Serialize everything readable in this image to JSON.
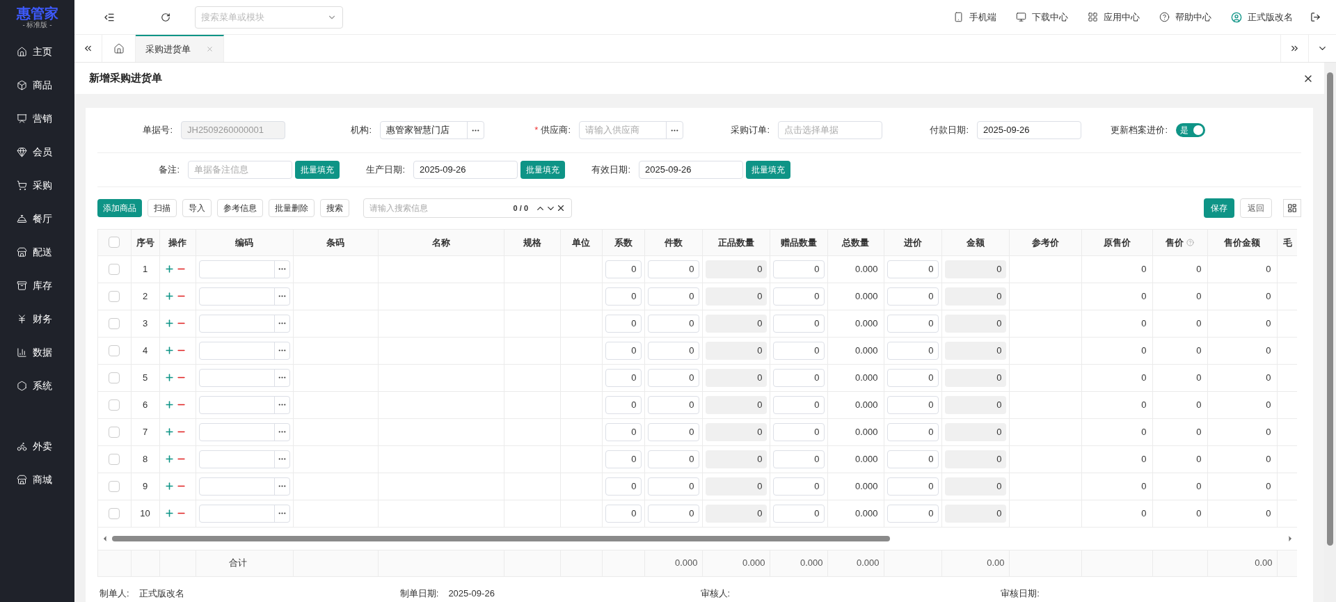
{
  "logo": {
    "name": "惠管家",
    "edition": "- 标准版 -"
  },
  "sidebar": {
    "items": [
      {
        "label": "主页"
      },
      {
        "label": "商品"
      },
      {
        "label": "营销"
      },
      {
        "label": "会员"
      },
      {
        "label": "采购"
      },
      {
        "label": "餐厅"
      },
      {
        "label": "配送"
      },
      {
        "label": "库存"
      },
      {
        "label": "财务"
      },
      {
        "label": "数据"
      },
      {
        "label": "系统"
      }
    ],
    "extra_items": [
      {
        "label": "外卖"
      },
      {
        "label": "商城"
      }
    ]
  },
  "topbar": {
    "search": {
      "placeholder": "搜索菜单或模块"
    },
    "links": [
      {
        "label": "手机端"
      },
      {
        "label": "下载中心"
      },
      {
        "label": "应用中心"
      },
      {
        "label": "帮助中心"
      }
    ],
    "user": "正式版改名"
  },
  "tabs": [
    {
      "label": "采购进货单",
      "selected": true
    }
  ],
  "page_title": "新增采购进货单",
  "form": {
    "rows": [
      [
        {
          "kind": "disabled",
          "label": "单据号:",
          "value": "JH2509260000001"
        },
        {
          "kind": "picker",
          "label": "机构:",
          "value": "惠管家智慧门店"
        },
        {
          "kind": "picker",
          "label": "供应商:",
          "mark": "*",
          "placeholder": "请输入供应商"
        },
        {
          "kind": "input",
          "label": "采购订单:",
          "placeholder": "点击选择单据"
        },
        {
          "kind": "input",
          "label": "付款日期:",
          "value": "2025-09-26"
        },
        {
          "kind": "switch",
          "label": "更新档案进价:",
          "value": "是",
          "on": true
        }
      ],
      [
        {
          "kind": "input",
          "label": "备注:",
          "placeholder": "单据备注信息",
          "fill_button": "批量填充"
        },
        {
          "kind": "input",
          "label": "生产日期:",
          "value": "2025-09-26",
          "fill_button": "批量填充"
        },
        {
          "kind": "input",
          "label": "有效日期:",
          "value": "2025-09-26",
          "fill_button": "批量填充"
        }
      ]
    ]
  },
  "toolbar": {
    "primary": "添加商品",
    "buttons": [
      "扫描",
      "导入",
      "参考信息",
      "批量删除",
      "搜索"
    ],
    "search": {
      "placeholder": "请输入搜索信息",
      "count": "0 / 0"
    },
    "save": "保存",
    "back": "返回"
  },
  "table": {
    "columns": [
      {
        "kind": "check",
        "checked": false
      },
      {
        "kind": "index",
        "label": "序号"
      },
      {
        "kind": "ops",
        "label": "操作"
      },
      {
        "kind": "code",
        "label": "编码",
        "total": "合计"
      },
      {
        "kind": "blank",
        "label": "条码"
      },
      {
        "kind": "blank",
        "label": "名称"
      },
      {
        "kind": "blank",
        "label": "规格"
      },
      {
        "kind": "blank",
        "label": "单位"
      },
      {
        "kind": "input",
        "label": "系数"
      },
      {
        "kind": "input",
        "label": "件数",
        "total": "0.000"
      },
      {
        "kind": "readonly",
        "label": "正品数量",
        "total": "0.000"
      },
      {
        "kind": "input",
        "label": "赠品数量",
        "total": "0.000"
      },
      {
        "kind": "text",
        "label": "总数量",
        "total": "0.000"
      },
      {
        "kind": "input",
        "label": "进价"
      },
      {
        "kind": "readonly",
        "label": "金额",
        "total": "0.00"
      },
      {
        "kind": "blank",
        "label": "参考价"
      },
      {
        "kind": "text",
        "label": "原售价"
      },
      {
        "kind": "text",
        "label": "售价",
        "help": true
      },
      {
        "kind": "text",
        "label": "售价金额",
        "total": "0.00"
      },
      {
        "kind": "blank",
        "label": "毛"
      }
    ],
    "rows": [
      {
        "checked": false,
        "cells": [
          "",
          "1",
          "",
          "",
          "",
          "",
          "",
          "",
          "0",
          "0",
          "0",
          "0",
          "0.000",
          "0",
          "0",
          "",
          "0",
          "0",
          "0",
          ""
        ]
      },
      {
        "checked": false,
        "cells": [
          "",
          "2",
          "",
          "",
          "",
          "",
          "",
          "",
          "0",
          "0",
          "0",
          "0",
          "0.000",
          "0",
          "0",
          "",
          "0",
          "0",
          "0",
          ""
        ]
      },
      {
        "checked": false,
        "cells": [
          "",
          "3",
          "",
          "",
          "",
          "",
          "",
          "",
          "0",
          "0",
          "0",
          "0",
          "0.000",
          "0",
          "0",
          "",
          "0",
          "0",
          "0",
          ""
        ]
      },
      {
        "checked": false,
        "cells": [
          "",
          "4",
          "",
          "",
          "",
          "",
          "",
          "",
          "0",
          "0",
          "0",
          "0",
          "0.000",
          "0",
          "0",
          "",
          "0",
          "0",
          "0",
          ""
        ]
      },
      {
        "checked": false,
        "cells": [
          "",
          "5",
          "",
          "",
          "",
          "",
          "",
          "",
          "0",
          "0",
          "0",
          "0",
          "0.000",
          "0",
          "0",
          "",
          "0",
          "0",
          "0",
          ""
        ]
      },
      {
        "checked": false,
        "cells": [
          "",
          "6",
          "",
          "",
          "",
          "",
          "",
          "",
          "0",
          "0",
          "0",
          "0",
          "0.000",
          "0",
          "0",
          "",
          "0",
          "0",
          "0",
          ""
        ]
      },
      {
        "checked": false,
        "cells": [
          "",
          "7",
          "",
          "",
          "",
          "",
          "",
          "",
          "0",
          "0",
          "0",
          "0",
          "0.000",
          "0",
          "0",
          "",
          "0",
          "0",
          "0",
          ""
        ]
      },
      {
        "checked": false,
        "cells": [
          "",
          "8",
          "",
          "",
          "",
          "",
          "",
          "",
          "0",
          "0",
          "0",
          "0",
          "0.000",
          "0",
          "0",
          "",
          "0",
          "0",
          "0",
          ""
        ]
      },
      {
        "checked": false,
        "cells": [
          "",
          "9",
          "",
          "",
          "",
          "",
          "",
          "",
          "0",
          "0",
          "0",
          "0",
          "0.000",
          "0",
          "0",
          "",
          "0",
          "0",
          "0",
          ""
        ]
      },
      {
        "checked": false,
        "cells": [
          "",
          "10",
          "",
          "",
          "",
          "",
          "",
          "",
          "0",
          "0",
          "0",
          "0",
          "0.000",
          "0",
          "0",
          "",
          "0",
          "0",
          "0",
          ""
        ]
      }
    ]
  },
  "footer": [
    {
      "label": "制单人:",
      "value": "正式版改名"
    },
    {
      "label": "制单日期:",
      "value": "2025-09-26"
    },
    {
      "label": "审核人:"
    },
    {
      "label": "审核日期:"
    }
  ]
}
